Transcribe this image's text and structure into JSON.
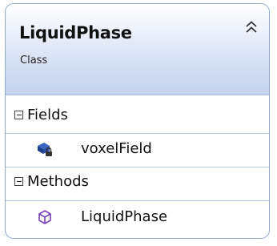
{
  "class_shape": {
    "name": "LiquidPhase",
    "stereotype": "Class",
    "collapse_icon": "double-chevron-up-icon"
  },
  "sections": {
    "fields": {
      "label": "Fields",
      "toggle_icon": "minus-box-icon",
      "items": [
        {
          "label": "voxelField",
          "icon": "private-field-icon"
        }
      ]
    },
    "methods": {
      "label": "Methods",
      "toggle_icon": "minus-box-icon",
      "items": [
        {
          "label": "LiquidPhase",
          "icon": "method-cube-icon"
        }
      ]
    }
  },
  "colors": {
    "border": "#8fa9cb",
    "header_gradient_end": "#c6d3ee",
    "field_icon": "#1c3e8c",
    "method_icon": "#7a3fb5"
  }
}
